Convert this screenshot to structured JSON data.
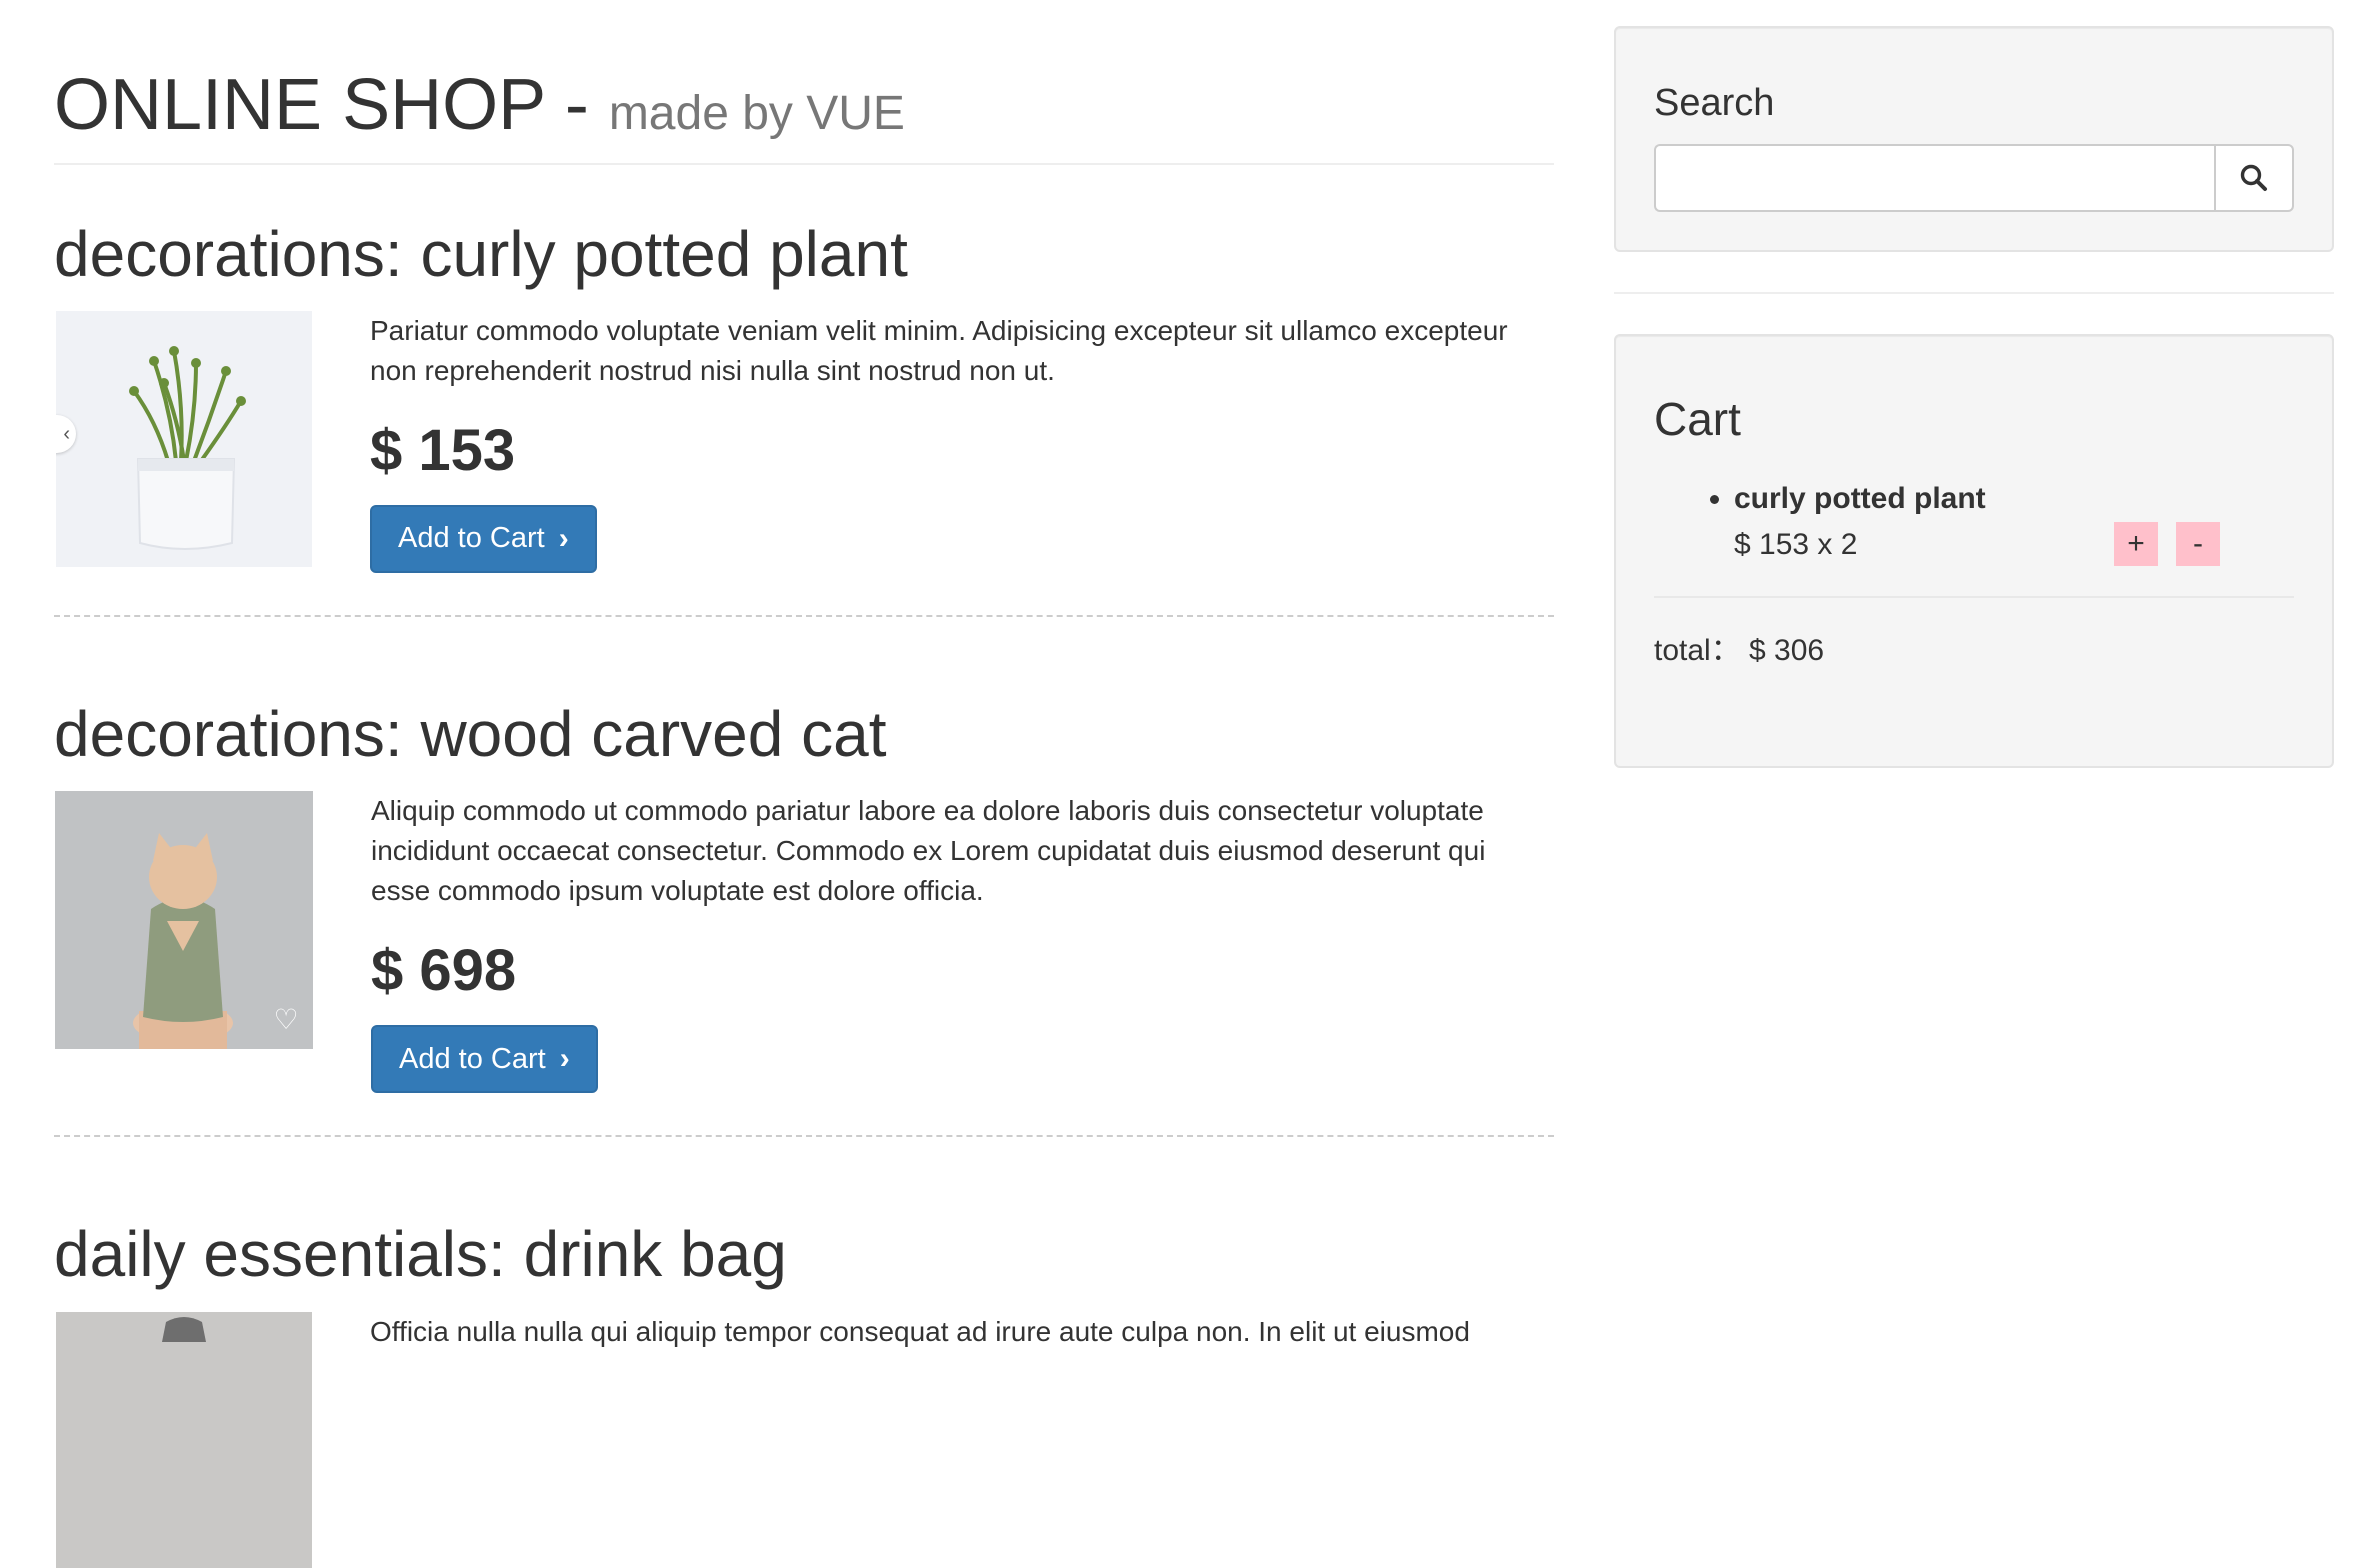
{
  "header": {
    "title": "ONLINE SHOP - ",
    "subtitle": "made by VUE"
  },
  "products": [
    {
      "title": "decorations: curly potted plant",
      "image_icon": "potted-plant-image",
      "description": "Pariatur commodo voluptate veniam velit minim. Adipisicing excepteur sit ullamco excepteur non reprehenderit nostrud nisi nulla sint nostrud non ut.",
      "price": "$ 153",
      "button_label": "Add to Cart"
    },
    {
      "title": "decorations: wood carved cat",
      "image_icon": "carved-cat-image",
      "description": "Aliquip commodo ut commodo pariatur labore ea dolore laboris duis consectetur voluptate incididunt occaecat consectetur. Commodo ex Lorem cupidatat duis eiusmod deserunt qui esse commodo ipsum voluptate est dolore officia.",
      "price": "$ 698",
      "button_label": "Add to Cart"
    },
    {
      "title": "daily essentials: drink bag",
      "image_icon": "drink-bag-image",
      "description": "Officia nulla nulla qui aliquip tempor consequat ad irure aute culpa non. In elit ut eiusmod"
    }
  ],
  "search": {
    "title": "Search",
    "value": "",
    "icon": "search-icon"
  },
  "cart": {
    "title": "Cart",
    "items": [
      {
        "name": "curly potted plant",
        "qty_line": "$ 153 x 2",
        "plus_label": "+",
        "minus_label": "-"
      }
    ],
    "total_label": "total： $ 306"
  },
  "colors": {
    "primary": "#337ab7",
    "qty_button": "#ffc0cb",
    "well_bg": "#f5f5f5"
  }
}
